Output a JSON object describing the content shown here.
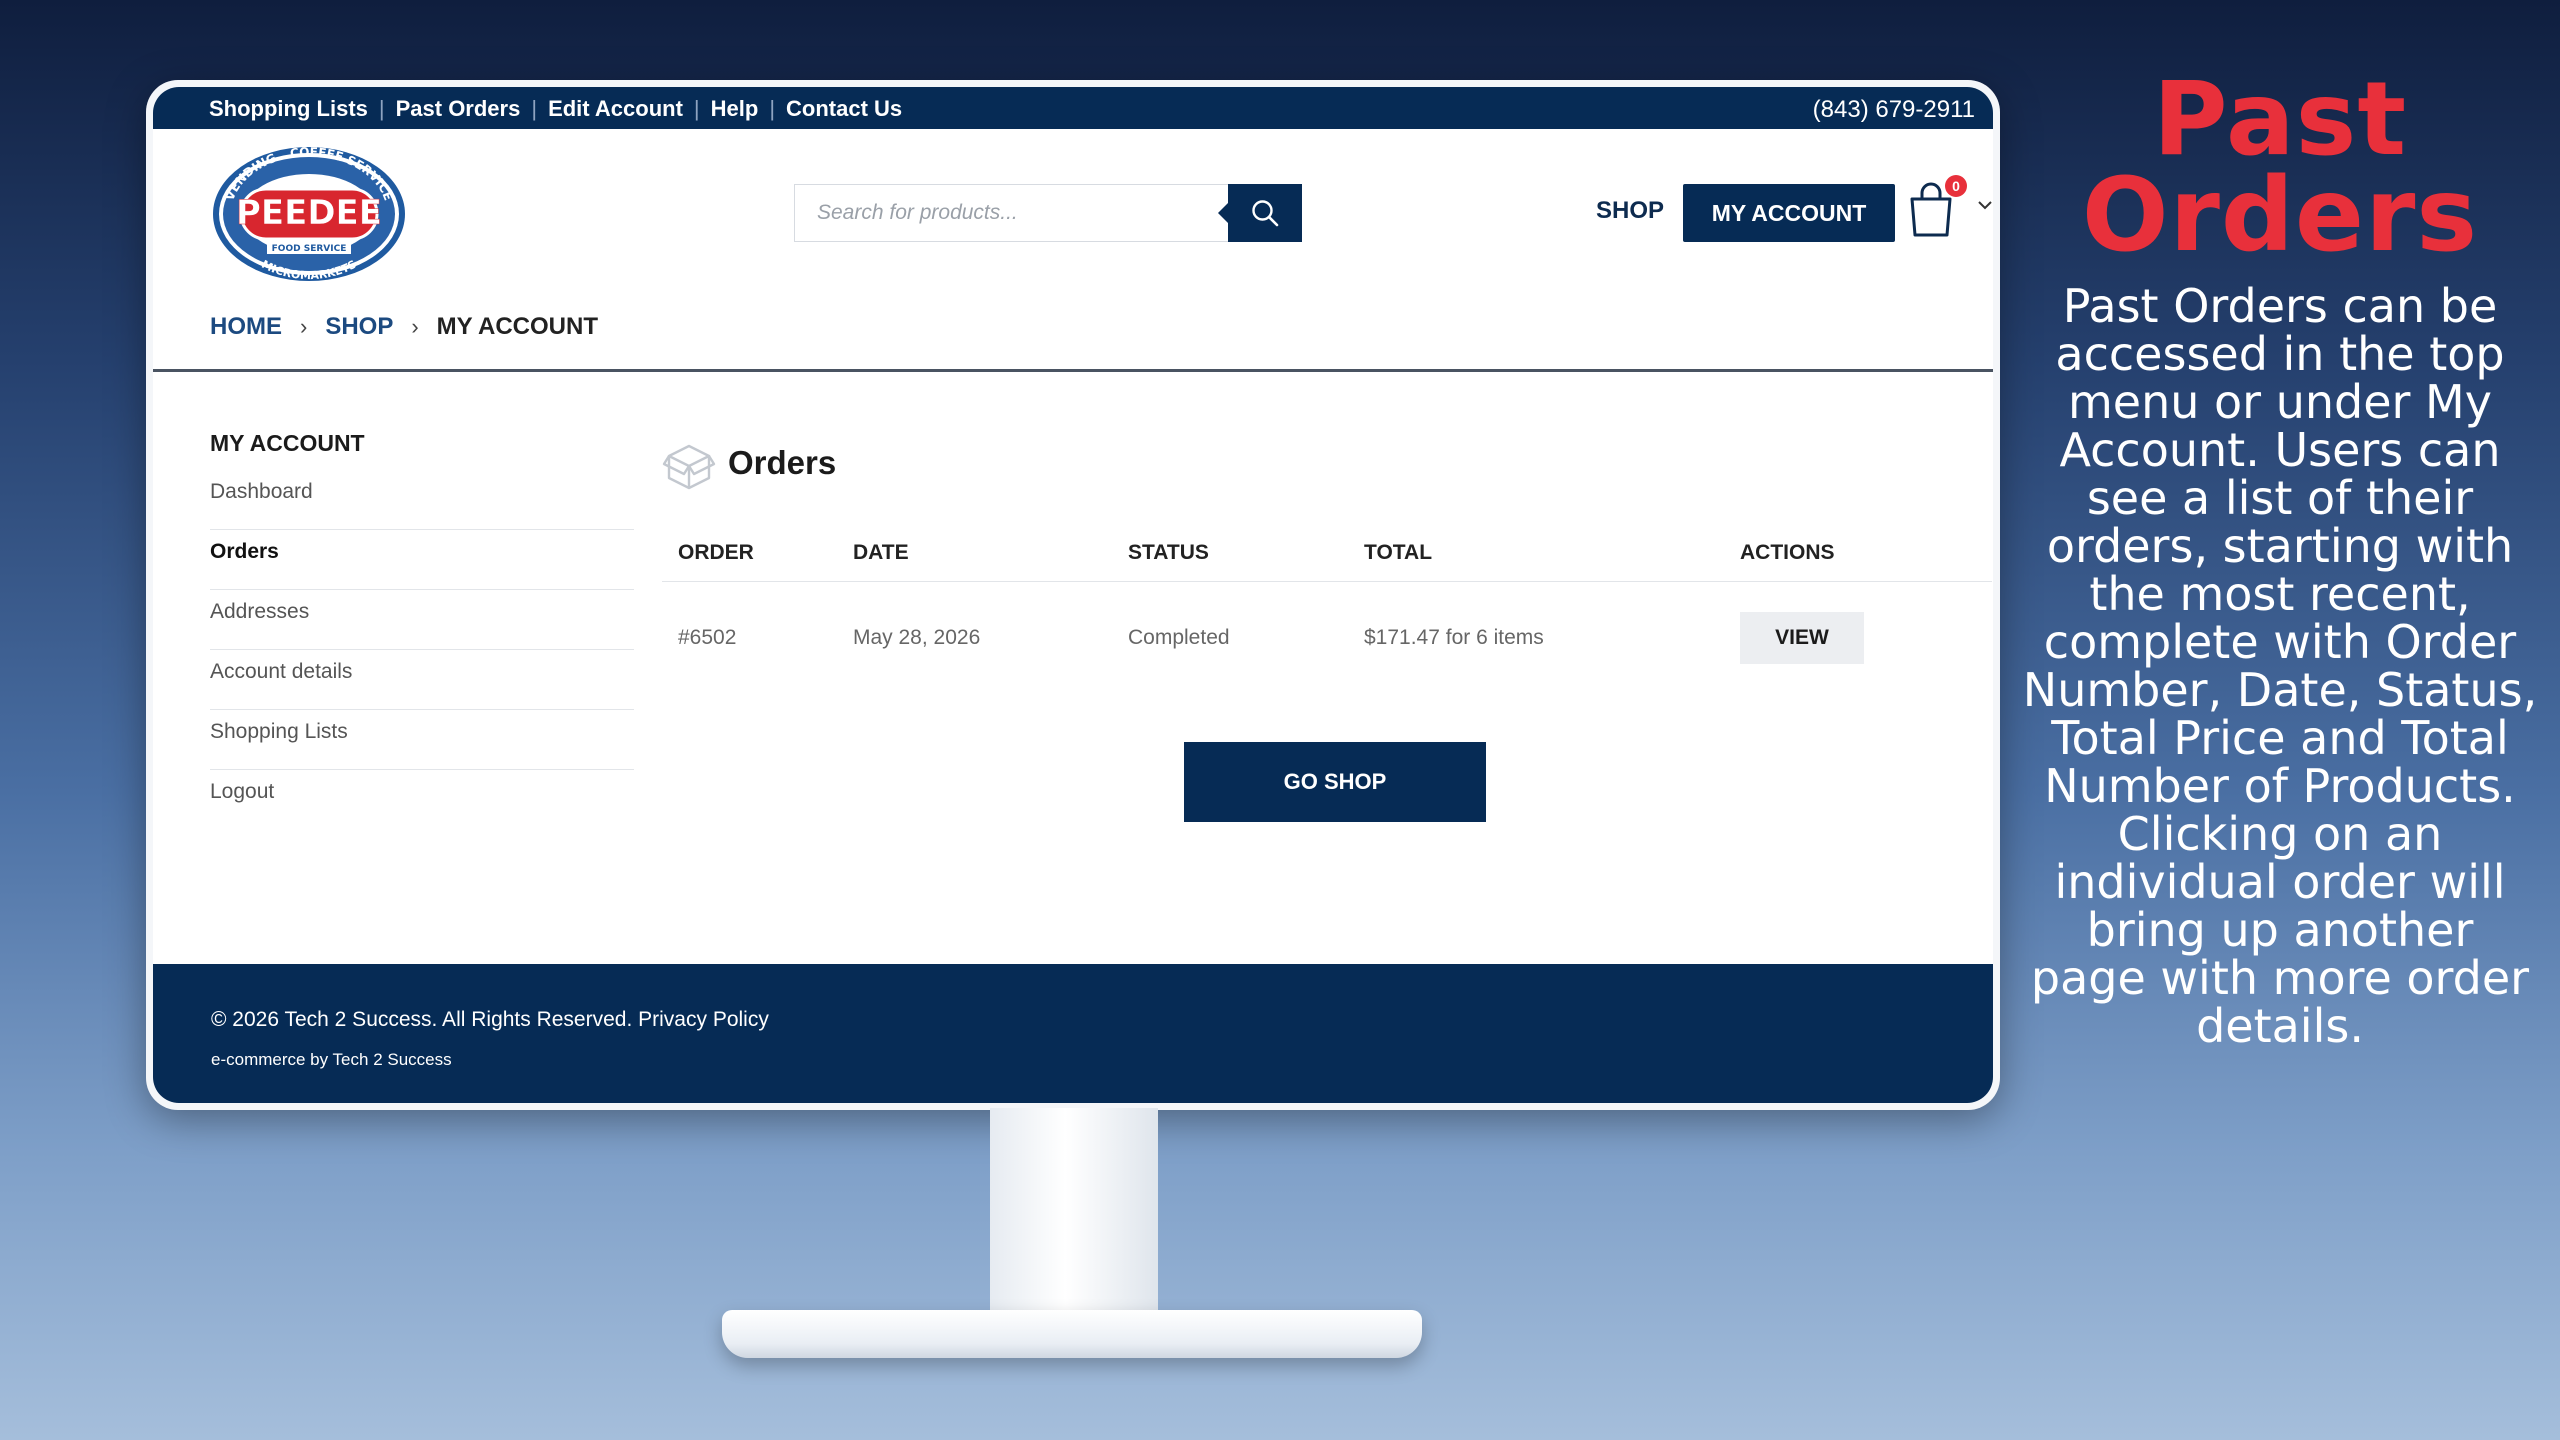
{
  "topbar": {
    "links": [
      "Shopping Lists",
      "Past Orders",
      "Edit Account",
      "Help",
      "Contact Us"
    ],
    "phone": "(843) 679-2911"
  },
  "logo": {
    "brand": "PEEDEE",
    "ring_top_left": "VENDING",
    "ring_top_right": "COFFEE SERVICE",
    "ring_bottom": "MICROMARKETS",
    "ribbon": "FOOD SERVICE"
  },
  "header": {
    "search_placeholder": "Search for products...",
    "shop_label": "SHOP",
    "my_account_label": "MY ACCOUNT",
    "cart_count": "0"
  },
  "breadcrumb": {
    "home": "HOME",
    "shop": "SHOP",
    "current": "MY ACCOUNT"
  },
  "sidebar": {
    "title": "MY ACCOUNT",
    "items": [
      {
        "label": "Dashboard"
      },
      {
        "label": "Orders"
      },
      {
        "label": "Addresses"
      },
      {
        "label": "Account details"
      },
      {
        "label": "Shopping Lists"
      },
      {
        "label": "Logout"
      }
    ]
  },
  "orders": {
    "title": "Orders",
    "columns": [
      "ORDER",
      "DATE",
      "STATUS",
      "TOTAL",
      "ACTIONS"
    ],
    "rows": [
      {
        "order": "#6502",
        "date": "May 28, 2026",
        "status": "Completed",
        "total": "$171.47 for 6 items",
        "action": "VIEW"
      }
    ],
    "go_shop": "GO SHOP"
  },
  "footer": {
    "copyright": "© 2026 Tech 2 Success. All Rights Reserved. Privacy Policy",
    "credit": "e-commerce by Tech 2 Success"
  },
  "promo": {
    "title": "Past Orders",
    "body": "Past Orders can be accessed in the top menu or under My Account. Users can see a list of their orders, starting with the most recent, complete with Order Number, Date, Status, Total Price and Total Number of Products. Clicking on an individual order will bring up another page with more order details."
  },
  "colors": {
    "navy": "#062b55",
    "accent_red": "#e8303b",
    "link_blue": "#1c4a80"
  },
  "icons": {
    "search": "magnifier-icon",
    "cart": "shopping-bag-icon",
    "orders": "box-icon",
    "dropdown": "chevron-down-icon"
  }
}
